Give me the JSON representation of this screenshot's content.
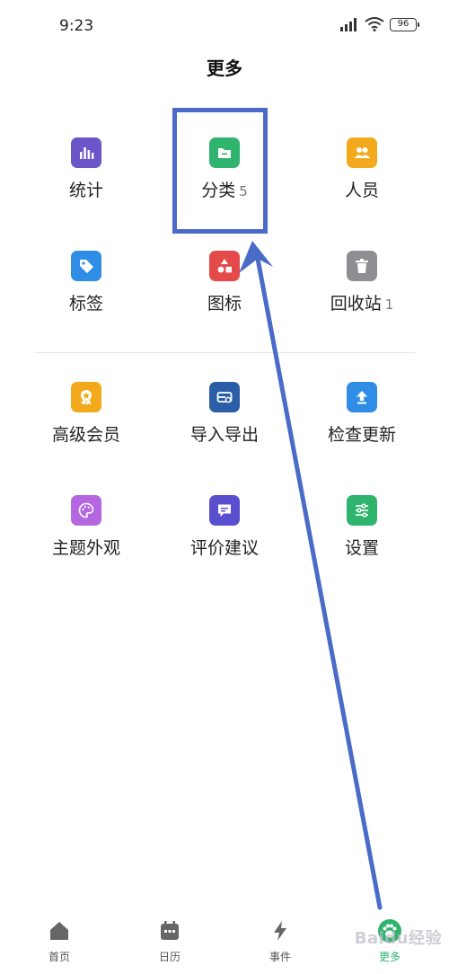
{
  "status_bar": {
    "time": "9:23",
    "battery": "96"
  },
  "page": {
    "title": "更多"
  },
  "grid": [
    {
      "label": "统计",
      "badge": "",
      "color": "#6a56c8",
      "icon": "bar-chart-icon"
    },
    {
      "label": "分类",
      "badge": "5",
      "color": "#2fb46e",
      "icon": "folder-icon"
    },
    {
      "label": "人员",
      "badge": "",
      "color": "#f3a91c",
      "icon": "people-icon"
    },
    {
      "label": "标签",
      "badge": "",
      "color": "#2f8de6",
      "icon": "tag-icon"
    },
    {
      "label": "图标",
      "badge": "",
      "color": "#e54a4a",
      "icon": "shapes-icon"
    },
    {
      "label": "回收站",
      "badge": "1",
      "color": "#8e8e93",
      "icon": "trash-icon"
    },
    {
      "label": "高级会员",
      "badge": "",
      "color": "#f3a91c",
      "icon": "premium-badge-icon"
    },
    {
      "label": "导入导出",
      "badge": "",
      "color": "#2a5fa8",
      "icon": "import-export-icon"
    },
    {
      "label": "检查更新",
      "badge": "",
      "color": "#2f8de6",
      "icon": "update-arrow-icon"
    },
    {
      "label": "主题外观",
      "badge": "",
      "color": "#b467e0",
      "icon": "palette-icon"
    },
    {
      "label": "评价建议",
      "badge": "",
      "color": "#5a4fcf",
      "icon": "feedback-icon"
    },
    {
      "label": "设置",
      "badge": "",
      "color": "#2fb46e",
      "icon": "sliders-icon"
    }
  ],
  "tabs": [
    {
      "label": "首页",
      "icon": "home-icon"
    },
    {
      "label": "日历",
      "icon": "calendar-icon"
    },
    {
      "label": "事件",
      "icon": "lightning-icon"
    },
    {
      "label": "更多",
      "icon": "paw-icon",
      "active": true
    }
  ],
  "annotation": {
    "highlight_color": "#4a6bc7"
  },
  "watermark": "Baidu经验"
}
